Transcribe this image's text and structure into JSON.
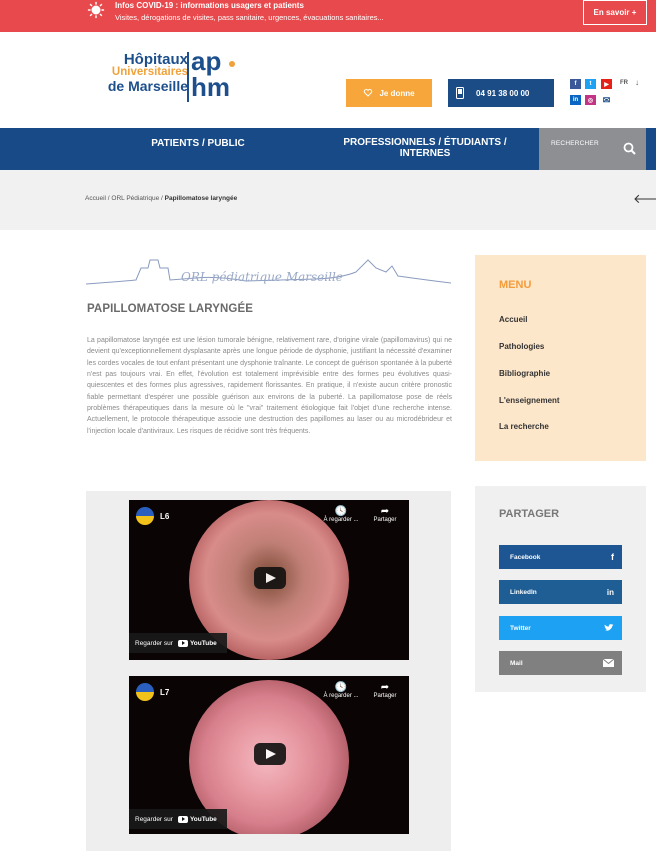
{
  "alert": {
    "title": "Infos COVID-19 : informations usagers et patients",
    "subtitle": "Visites, dérogations de visites, pass sanitaire, urgences, évacuations sanitaires...",
    "button": "En savoir +",
    "icon": "virus-icon"
  },
  "header": {
    "logo_line1": "Hôpitaux",
    "logo_line2": "Universitaires",
    "logo_line3": "de Marseille",
    "logo_mark_top": "ap",
    "logo_mark_bottom": "hm",
    "donate_label": "Je donne",
    "phone": "04 91 38 00 00",
    "lang": "FR",
    "social": [
      {
        "name": "facebook-icon",
        "glyph": "f",
        "color": "#3b5998"
      },
      {
        "name": "twitter-icon",
        "glyph": "t",
        "color": "#1da1f2"
      },
      {
        "name": "youtube-icon",
        "glyph": "▶",
        "color": "#e62117"
      },
      {
        "name": "linkedin-icon",
        "glyph": "in",
        "color": "#0a66c2"
      },
      {
        "name": "instagram-icon",
        "glyph": "◎",
        "color": "#c13584"
      },
      {
        "name": "mail-icon",
        "glyph": "✉",
        "color": "#ffffff"
      }
    ]
  },
  "nav": {
    "item1": "PATIENTS / PUBLIC",
    "item2": "PROFESSIONNELS / ÉTUDIANTS / INTERNES",
    "search_label": "RECHERCHER"
  },
  "breadcrumb": {
    "home": "Accueil",
    "sep": " / ",
    "section": "ORL Pédiatrique",
    "current": "Papillomatose laryngée"
  },
  "main": {
    "banner_text": "ORL pédiatrique Marseille",
    "title": "PAPILLOMATOSE LARYNGÉE",
    "body": "La papillomatose laryngée est une lésion tumorale bénigne, relativement rare, d'origine virale (papillomavirus) qui ne devient qu'exceptionnellement dysplasante après une longue période de dysphonie, justifiant la nécessité d'examiner les cordes vocales de tout enfant présentant une dysphonie traînante. Le concept de guérison spontanée à la puberté n'est pas toujours vrai. En effet, l'évolution est totalement imprévisible entre des formes peu évolutives quasi-quiescentes et des formes plus agressives, rapidement florissantes. En pratique, il n'existe aucun critère pronostic fiable permettant d'espérer une possible guérison aux environs de la puberté. La papillomatose pose de réels problèmes thérapeutiques dans la mesure où le \"vrai\" traitement étiologique fait l'objet d'une recherche intense. Actuellement, le protocole thérapeutique associe une destruction des papillomes au laser ou au microdébrideur et l'injection locale d'antiviraux. Les risques de récidive sont très fréquents.",
    "videos": [
      {
        "title": "L6",
        "later": "À regarder ...",
        "share": "Partager",
        "watch": "Regarder sur",
        "yt": "YouTube"
      },
      {
        "title": "L7",
        "later": "À regarder ...",
        "share": "Partager",
        "watch": "Regarder sur",
        "yt": "YouTube"
      }
    ]
  },
  "menu": {
    "title": "MENU",
    "items": [
      "Accueil",
      "Pathologies",
      "Bibliographie",
      "L'enseignement",
      "La recherche"
    ]
  },
  "share": {
    "title": "PARTAGER",
    "buttons": [
      {
        "label": "Facebook",
        "icon": "facebook-icon",
        "glyph": "f",
        "color": "#1e5593"
      },
      {
        "label": "LinkedIn",
        "icon": "linkedin-icon",
        "glyph": "in",
        "color": "#1e5e94"
      },
      {
        "label": "Twitter",
        "icon": "twitter-icon",
        "glyph": "🐦",
        "color": "#1da1f2"
      },
      {
        "label": "Mail",
        "icon": "mail-icon",
        "glyph": "✉",
        "color": "#808080"
      }
    ]
  }
}
